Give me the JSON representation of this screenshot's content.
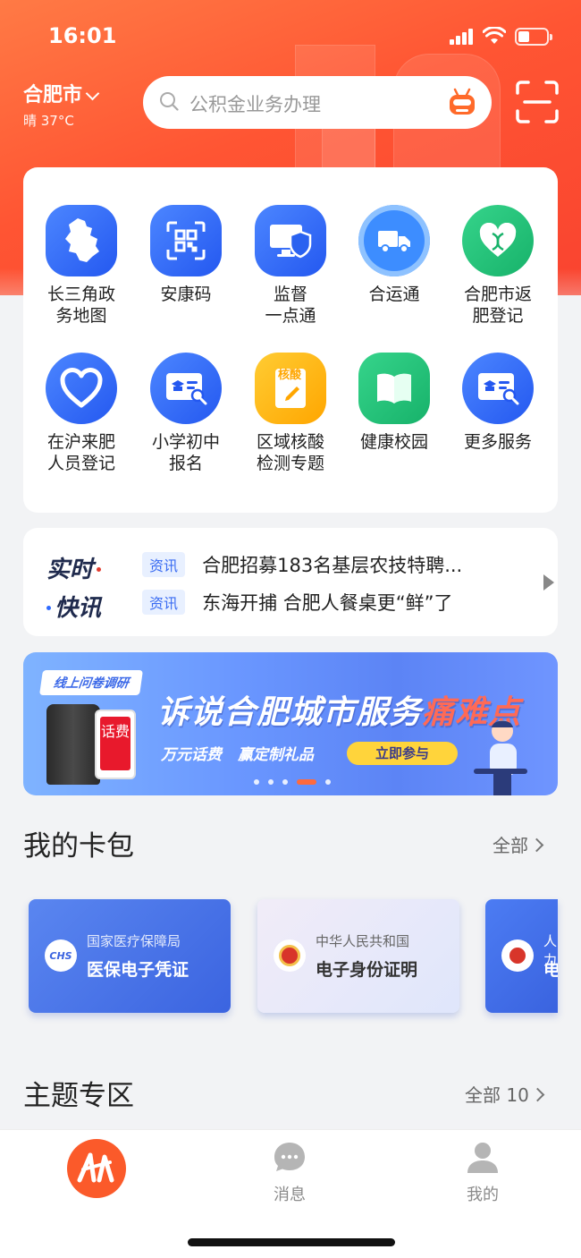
{
  "status_bar": {
    "time": "16:01"
  },
  "location": {
    "city": "合肥市",
    "weather": "晴 37°C"
  },
  "search": {
    "placeholder": "公积金业务办理"
  },
  "services": [
    {
      "label": "长三角政务地图",
      "l1": "长三角政",
      "l2": "务地图",
      "icon": "map-icon",
      "color": "#2f6bff"
    },
    {
      "label": "安康码",
      "l1": "安康码",
      "l2": "",
      "icon": "qr-code-icon",
      "color": "#2f6bff"
    },
    {
      "label": "监督一点通",
      "l1": "监督",
      "l2": "一点通",
      "icon": "monitor-shield-icon",
      "color": "#2f6bff"
    },
    {
      "label": "合运通",
      "l1": "合运通",
      "l2": "",
      "icon": "truck-icon",
      "color": "#3d8dff"
    },
    {
      "label": "合肥市返肥登记",
      "l1": "合肥市返",
      "l2": "肥登记",
      "icon": "heart-dna-icon",
      "color": "#1ebe75"
    },
    {
      "label": "在沪来肥人员登记",
      "l1": "在沪来肥",
      "l2": "人员登记",
      "icon": "heart-icon",
      "color": "#2f6bff"
    },
    {
      "label": "小学初中报名",
      "l1": "小学初中",
      "l2": "报名",
      "icon": "id-card-icon",
      "color": "#2f6bff"
    },
    {
      "label": "区域核酸检测专题",
      "l1": "区域核酸",
      "l2": "检测专题",
      "icon": "nucleic-test-icon",
      "color": "#ffb300",
      "badge": "核酸"
    },
    {
      "label": "健康校园",
      "l1": "健康校园",
      "l2": "",
      "icon": "book-icon",
      "color": "#1ebe75"
    },
    {
      "label": "更多服务",
      "l1": "更多服务",
      "l2": "",
      "icon": "id-card-icon",
      "color": "#2f6bff"
    }
  ],
  "news": {
    "logo_line1": "实时",
    "logo_line2": "快讯",
    "items": [
      {
        "tag": "资讯",
        "text": "合肥招募183名基层农技特聘..."
      },
      {
        "tag": "资讯",
        "text": "东海开捕 合肥人餐桌更“鲜”了"
      }
    ]
  },
  "banner": {
    "ribbon": "线上问卷调研",
    "headline_main": "诉说合肥城市服务",
    "headline_highlight": "痛难点",
    "phone_text": "话费",
    "sub1": "万元话费",
    "sub2": "赢定制礼品",
    "cta": "立即参与",
    "dot_count": 5,
    "active_dot": 3
  },
  "wallet": {
    "title": "我的卡包",
    "more": "全部",
    "cards": [
      {
        "issuer": "国家医疗保障局",
        "name": "医保电子凭证",
        "emblem": "CHS"
      },
      {
        "issuer": "中华人民共和国",
        "name": "电子身份证明"
      },
      {
        "issuer": "人力",
        "name": "电"
      }
    ]
  },
  "topics": {
    "title": "主题专区",
    "more": "全部 10"
  },
  "tabbar": {
    "home_icon": "wanshitong-logo-icon",
    "messages": "消息",
    "mine": "我的"
  }
}
